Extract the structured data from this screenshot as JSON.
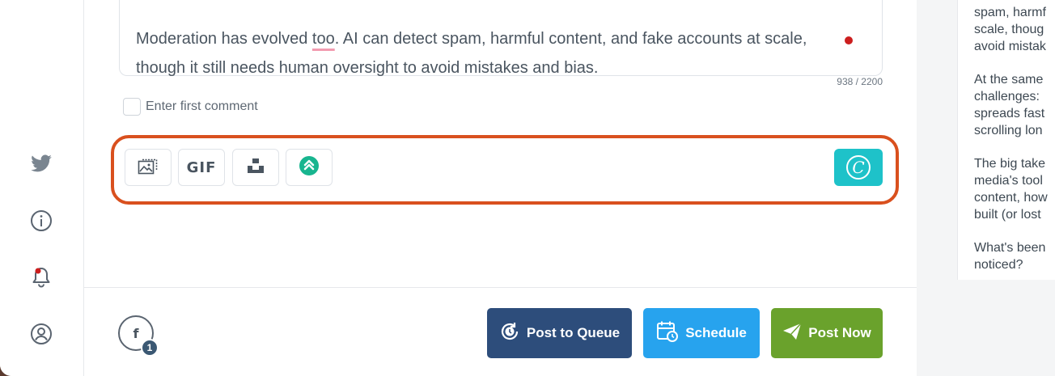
{
  "editor": {
    "text_before": "Moderation has evolved ",
    "text_misspelled": "too",
    "text_after": ". AI can detect spam, harmful content, and fake accounts at scale, though it still needs human oversight to avoid mistakes and bias.",
    "char_count": "938 / 2200"
  },
  "first_comment": {
    "label": "Enter first comment"
  },
  "toolbar": {
    "gif_label": "GIF",
    "canva_label": "C"
  },
  "account": {
    "network_letter": "f",
    "count": "1"
  },
  "actions": {
    "post_to_queue": "Post to Queue",
    "schedule": "Schedule",
    "post_now": "Post Now"
  },
  "preview": {
    "p1": "spam, harmf\nscale, thoug\navoid mistak",
    "p2": "At the same\nchallenges:\nspreads fast\nscrolling lon",
    "p3": "The big take\nmedia's tool\ncontent, how\nbuilt (or lost",
    "p4": "What's been\nnoticed?"
  },
  "colors": {
    "highlight": "#d9501e",
    "queue": "#2d4d7b",
    "schedule": "#27a3ee",
    "post_now": "#6aa22c",
    "canva": "#1ec2c9"
  },
  "icons": [
    "twitter-icon",
    "info-icon",
    "bell-icon",
    "user-icon",
    "image-icon",
    "gif-icon",
    "unsplash-icon",
    "upgrade-icon",
    "canva-icon",
    "clock-icon",
    "calendar-icon",
    "send-icon"
  ]
}
